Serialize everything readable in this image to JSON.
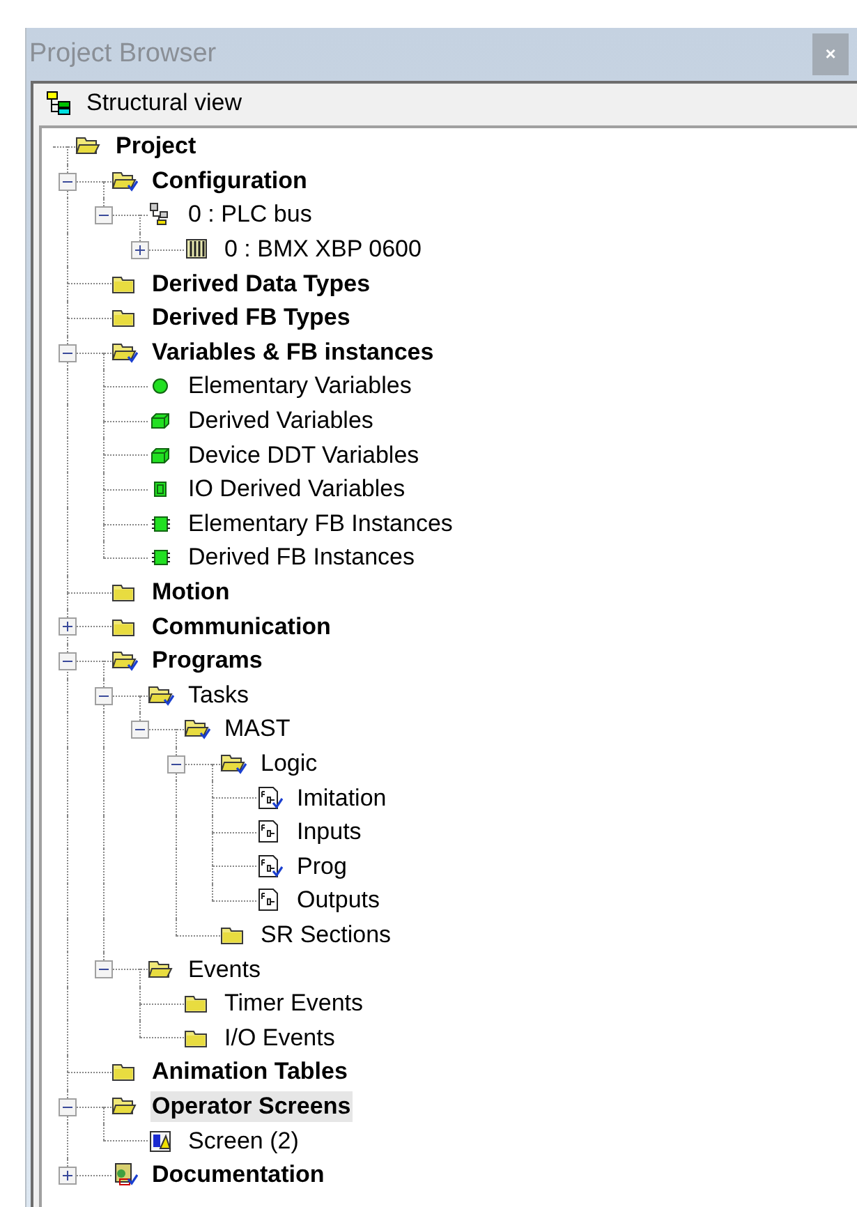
{
  "window": {
    "title": "Project Browser",
    "close": "×"
  },
  "view": {
    "label": "Structural view"
  },
  "tree": [
    {
      "label": "Project",
      "kind": "folder-open",
      "selected": false,
      "children": [
        {
          "label": "Configuration",
          "kind": "folder-open-check",
          "selected": false,
          "expanded": true,
          "children": [
            {
              "label": "0 : PLC bus",
              "kind": "bus",
              "selected": false,
              "expanded": true,
              "children": [
                {
                  "label": "0 : BMX XBP 0600",
                  "kind": "rack",
                  "selected": false,
                  "expanded": false
                }
              ]
            }
          ]
        },
        {
          "label": "Derived Data Types",
          "kind": "folder",
          "selected": false
        },
        {
          "label": "Derived FB Types",
          "kind": "folder",
          "selected": false
        },
        {
          "label": "Variables & FB instances",
          "kind": "folder-open-check",
          "selected": false,
          "expanded": true,
          "children": [
            {
              "label": "Elementary Variables",
              "kind": "dot",
              "selected": false
            },
            {
              "label": "Derived Variables",
              "kind": "cube",
              "selected": false
            },
            {
              "label": "Device DDT Variables",
              "kind": "cube",
              "selected": false
            },
            {
              "label": "IO Derived Variables",
              "kind": "chip-small",
              "selected": false
            },
            {
              "label": "Elementary FB Instances",
              "kind": "chip",
              "selected": false
            },
            {
              "label": "Derived FB Instances",
              "kind": "chip",
              "selected": false
            }
          ]
        },
        {
          "label": "Motion",
          "kind": "folder",
          "selected": false
        },
        {
          "label": "Communication",
          "kind": "folder",
          "selected": false,
          "expanded": false
        },
        {
          "label": "Programs",
          "kind": "folder-open-check",
          "selected": false,
          "expanded": true,
          "children": [
            {
              "label": "Tasks",
              "kind": "folder-open-check",
              "selected": false,
              "expanded": true,
              "children": [
                {
                  "label": "MAST",
                  "kind": "folder-open-check",
                  "selected": false,
                  "expanded": true,
                  "children": [
                    {
                      "label": "Logic",
                      "kind": "folder-open-check",
                      "selected": false,
                      "expanded": true,
                      "children": [
                        {
                          "label": "Imitation",
                          "kind": "fbd-check",
                          "selected": false
                        },
                        {
                          "label": "Inputs",
                          "kind": "fbd",
                          "selected": false
                        },
                        {
                          "label": "Prog",
                          "kind": "fbd-check",
                          "selected": false
                        },
                        {
                          "label": "Outputs",
                          "kind": "fbd",
                          "selected": false
                        }
                      ]
                    },
                    {
                      "label": "SR Sections",
                      "kind": "folder",
                      "selected": false
                    }
                  ]
                }
              ]
            },
            {
              "label": "Events",
              "kind": "folder-open",
              "selected": false,
              "expanded": true,
              "children": [
                {
                  "label": "Timer Events",
                  "kind": "folder",
                  "selected": false
                },
                {
                  "label": "I/O Events",
                  "kind": "folder",
                  "selected": false
                }
              ]
            }
          ]
        },
        {
          "label": "Animation Tables",
          "kind": "folder",
          "selected": false
        },
        {
          "label": "Operator Screens",
          "kind": "folder-open",
          "selected": true,
          "expanded": true,
          "children": [
            {
              "label": "Screen (2)",
              "kind": "screen",
              "selected": false
            }
          ]
        },
        {
          "label": "Documentation",
          "kind": "doc-check",
          "selected": false,
          "expanded": false
        }
      ]
    }
  ]
}
